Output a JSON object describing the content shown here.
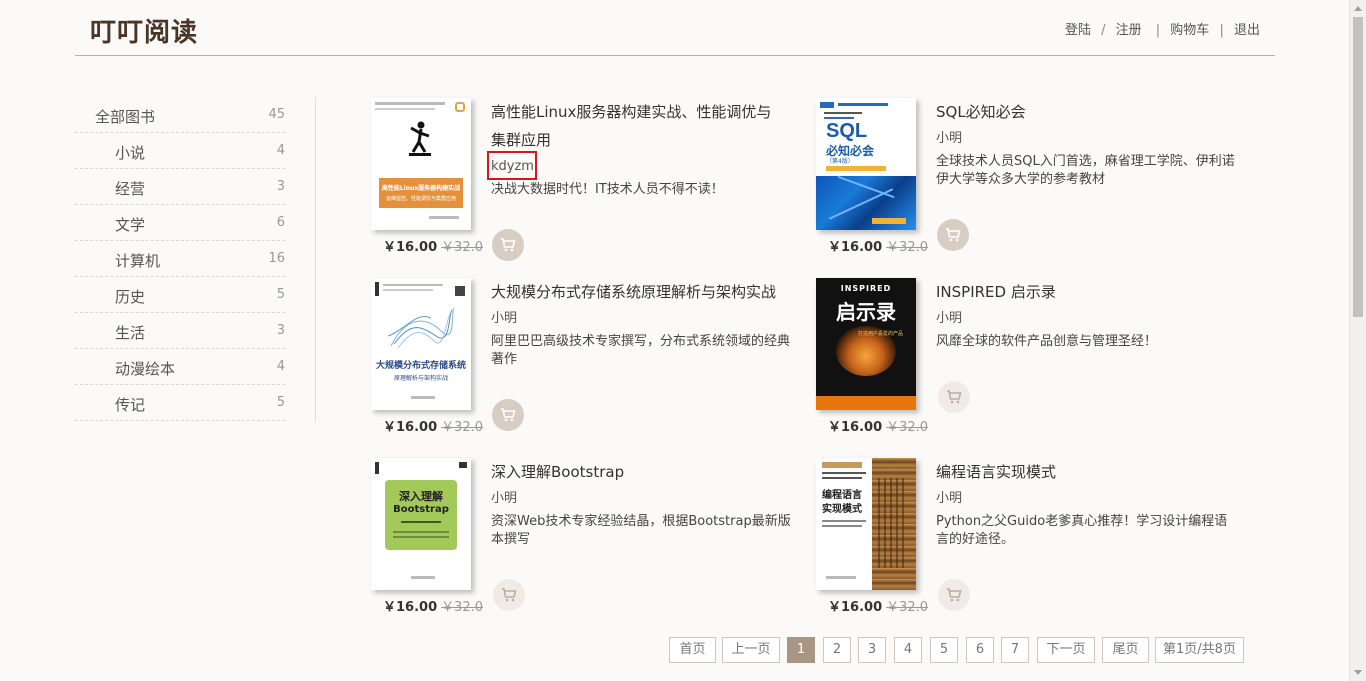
{
  "header": {
    "logo": "叮叮阅读",
    "nav": {
      "login": "登陆",
      "slash": "/",
      "register": "注册",
      "bar1": "|",
      "cart": "购物车",
      "bar2": "|",
      "logout": "退出"
    }
  },
  "categories": [
    {
      "name": "全部图书",
      "count": "45"
    },
    {
      "name": "小说",
      "count": "4"
    },
    {
      "name": "经营",
      "count": "3"
    },
    {
      "name": "文学",
      "count": "6"
    },
    {
      "name": "计算机",
      "count": "16"
    },
    {
      "name": "历史",
      "count": "5"
    },
    {
      "name": "生活",
      "count": "3"
    },
    {
      "name": "动漫绘本",
      "count": "4"
    },
    {
      "name": "传记",
      "count": "5"
    }
  ],
  "books": [
    {
      "title": "高性能Linux服务器构建实战、性能调优与集群应用",
      "author": "kdyzm",
      "desc": "决战大数据时代！IT技术人员不得不读！",
      "price": "￥16.00",
      "old_price": "￥32.0",
      "cover": {
        "text1": "高性能Linux服务器构建实战",
        "text2": "运维监控、性能调优与集群应用"
      }
    },
    {
      "title": "SQL必知必会",
      "author": "小明",
      "desc": "全球技术人员SQL入门首选，麻省理工学院、伊利诺伊大学等众多大学的参考教材",
      "price": "￥16.00",
      "old_price": "￥32.0",
      "cover": {
        "text1": "SQL",
        "text2": "必知必会",
        "text3": "（第4版）"
      }
    },
    {
      "title": "大规模分布式存储系统原理解析与架构实战",
      "author": "小明",
      "desc": "阿里巴巴高级技术专家撰写，分布式系统领域的经典著作",
      "price": "￥16.00",
      "old_price": "￥32.0",
      "cover": {
        "text1": "大规模分布式存储系统",
        "text2": "原理解析与架构实战"
      }
    },
    {
      "title": "INSPIRED 启示录",
      "author": "小明",
      "desc": "风靡全球的软件产品创意与管理圣经！",
      "price": "￥16.00",
      "old_price": "￥32.0",
      "cover": {
        "text1": "INSPIRED",
        "text2": "启示录",
        "text3": "打造用户喜爱的产品"
      }
    },
    {
      "title": "深入理解Bootstrap",
      "author": "小明",
      "desc": "资深Web技术专家经验结晶，根据Bootstrap最新版本撰写",
      "price": "￥16.00",
      "old_price": "￥32.0",
      "cover": {
        "text1": "深入理解",
        "text2": "Bootstrap"
      }
    },
    {
      "title": "编程语言实现模式",
      "author": "小明",
      "desc": "Python之父Guido老爹真心推荐！学习设计编程语言的好途径。",
      "price": "￥16.00",
      "old_price": "￥32.0",
      "cover": {
        "text1": "编程语言",
        "text2": "实现模式"
      }
    }
  ],
  "pager": {
    "first": "首页",
    "prev": "上一页",
    "pages": [
      "1",
      "2",
      "3",
      "4",
      "5",
      "6",
      "7"
    ],
    "next": "下一页",
    "last": "尾页",
    "info": "第1页/共8页",
    "current": "1"
  },
  "colors": {
    "accent": "#a89684",
    "highlight": "#d9161c",
    "logo": "#4a3527"
  }
}
